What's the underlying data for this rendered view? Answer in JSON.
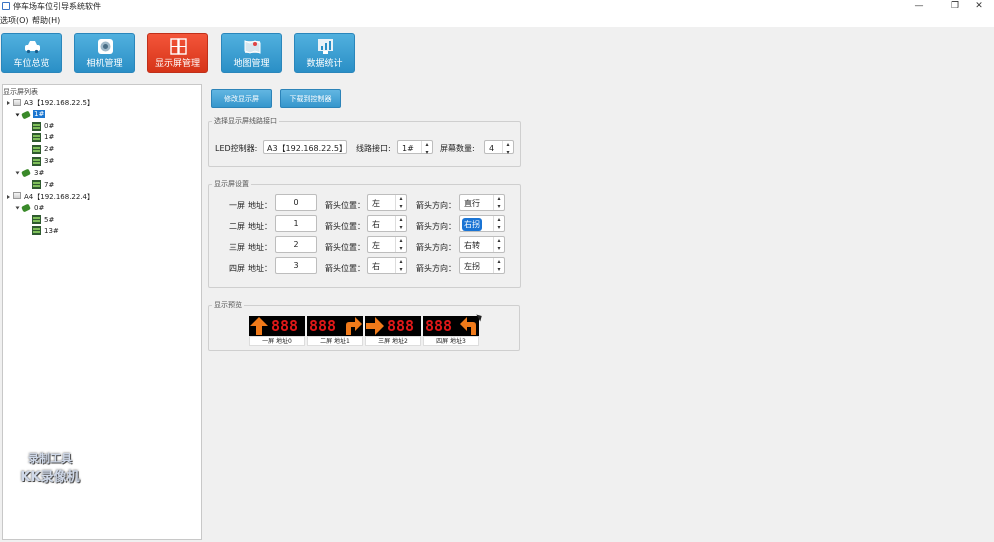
{
  "window": {
    "title": "停车场车位引导系统软件",
    "minimize": "—",
    "maximize": "❐",
    "close": "✕"
  },
  "menu": {
    "options": "选项(O)",
    "help": "帮助(H)"
  },
  "toolbar": {
    "items": [
      {
        "label": "车位总览",
        "icon": "car-icon"
      },
      {
        "label": "相机管理",
        "icon": "camera-icon"
      },
      {
        "label": "显示屏管理",
        "icon": "display-icon"
      },
      {
        "label": "地图管理",
        "icon": "map-icon"
      },
      {
        "label": "数据统计",
        "icon": "chart-icon"
      }
    ],
    "active_index": 2
  },
  "tree": {
    "title": "显示屏列表",
    "controllers": [
      {
        "label": "A3【192.168.22.5】",
        "lines": [
          {
            "label": "1#",
            "selected": true,
            "screens": [
              "0#",
              "1#",
              "2#",
              "3#"
            ]
          },
          {
            "label": "3#",
            "screens": [
              "7#"
            ]
          }
        ]
      },
      {
        "label": "A4【192.168.22.4】",
        "lines": [
          {
            "label": "0#",
            "screens": [
              "5#",
              "13#"
            ]
          }
        ]
      }
    ]
  },
  "watermark": {
    "line1": "录制工具",
    "line2": "KK录像机"
  },
  "actions": {
    "modify": "修改显示屏",
    "download": "下载到控制器"
  },
  "select_group": {
    "title": "选择显示屏线路接口",
    "led_label": "LED控制器:",
    "led_value": "A3【192.168.22.5】",
    "port_label": "线路接口:",
    "port_value": "1#",
    "count_label": "屏幕数量:",
    "count_value": "4"
  },
  "settings_group": {
    "title": "显示屏设置",
    "addr_suffix": "地址：",
    "pos_label": "箭头位置：",
    "dir_label": "箭头方向：",
    "rows": [
      {
        "name": "一屏",
        "address": "0",
        "position": "左",
        "direction": "直行"
      },
      {
        "name": "二屏",
        "address": "1",
        "position": "右",
        "direction": "右拐",
        "direction_highlight": true
      },
      {
        "name": "三屏",
        "address": "2",
        "position": "左",
        "direction": "右转"
      },
      {
        "name": "四屏",
        "address": "3",
        "position": "右",
        "direction": "左拐"
      }
    ]
  },
  "preview_group": {
    "title": "显示预览",
    "panels": [
      {
        "label": "一屏 地址0",
        "digits": "888",
        "arrow": "up",
        "arrow_side": "left"
      },
      {
        "label": "二屏 地址1",
        "digits": "888",
        "arrow": "turn-right",
        "arrow_side": "right"
      },
      {
        "label": "三屏 地址2",
        "digits": "888",
        "arrow": "right",
        "arrow_side": "left"
      },
      {
        "label": "四屏 地址3",
        "digits": "888",
        "arrow": "turn-left",
        "arrow_side": "right"
      }
    ]
  },
  "colors": {
    "accent": "#2a8fc6",
    "active": "#e0401f",
    "led_red": "#e01818",
    "arrow_orange": "#f07a1a"
  }
}
